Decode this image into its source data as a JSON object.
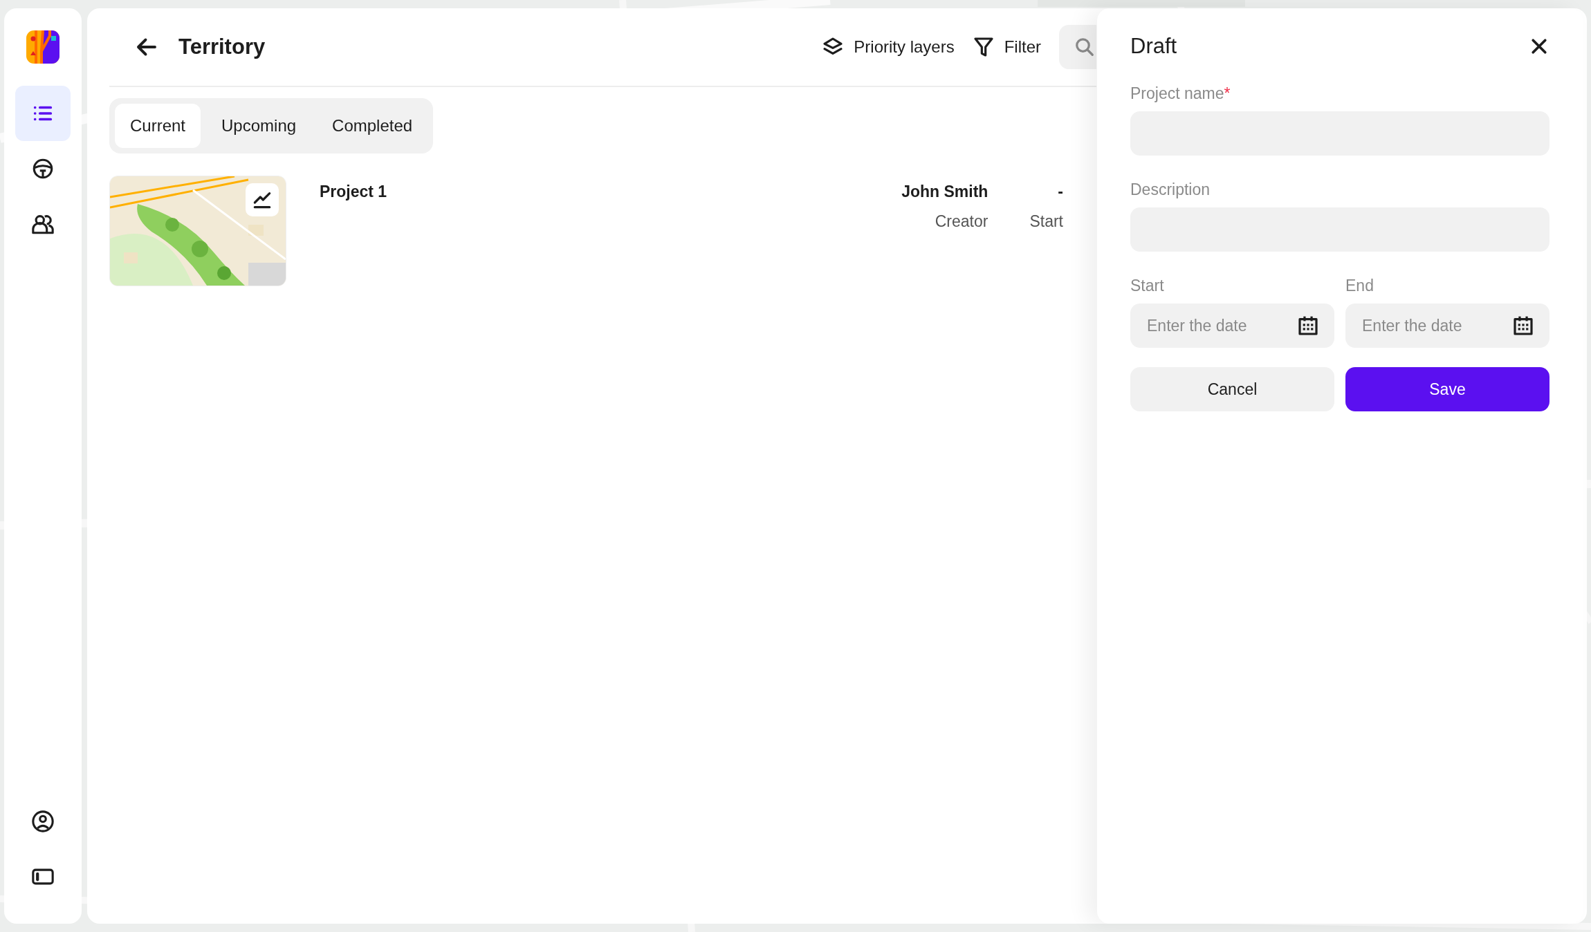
{
  "sidebar": {
    "items": [
      {
        "kind": "list",
        "selected": true
      },
      {
        "kind": "wheel",
        "selected": false
      },
      {
        "kind": "people",
        "selected": false
      }
    ],
    "bottom_items": [
      {
        "kind": "profile"
      },
      {
        "kind": "panel"
      }
    ]
  },
  "header": {
    "title": "Territory",
    "actions": [
      {
        "kind": "layers",
        "label": "Priority layers"
      },
      {
        "kind": "filter",
        "label": "Filter"
      }
    ]
  },
  "tabs": [
    {
      "label": "Current",
      "selected": true
    },
    {
      "label": "Upcoming",
      "selected": false
    },
    {
      "label": "Completed",
      "selected": false
    }
  ],
  "projects": [
    {
      "name": "Project 1",
      "creator": "John Smith",
      "creator_label": "Creator",
      "start": "-",
      "start_label": "Start"
    }
  ],
  "drawer": {
    "title": "Draft",
    "fields": [
      {
        "label": "Project name",
        "required_mark": "*"
      },
      {
        "label": "Description"
      }
    ],
    "dates": [
      {
        "label": "Start",
        "placeholder": "Enter the date"
      },
      {
        "label": "End",
        "placeholder": "Enter the date"
      }
    ],
    "buttons": [
      {
        "kind": "secondary",
        "label": "Cancel"
      },
      {
        "kind": "primary",
        "label": "Save"
      }
    ]
  }
}
